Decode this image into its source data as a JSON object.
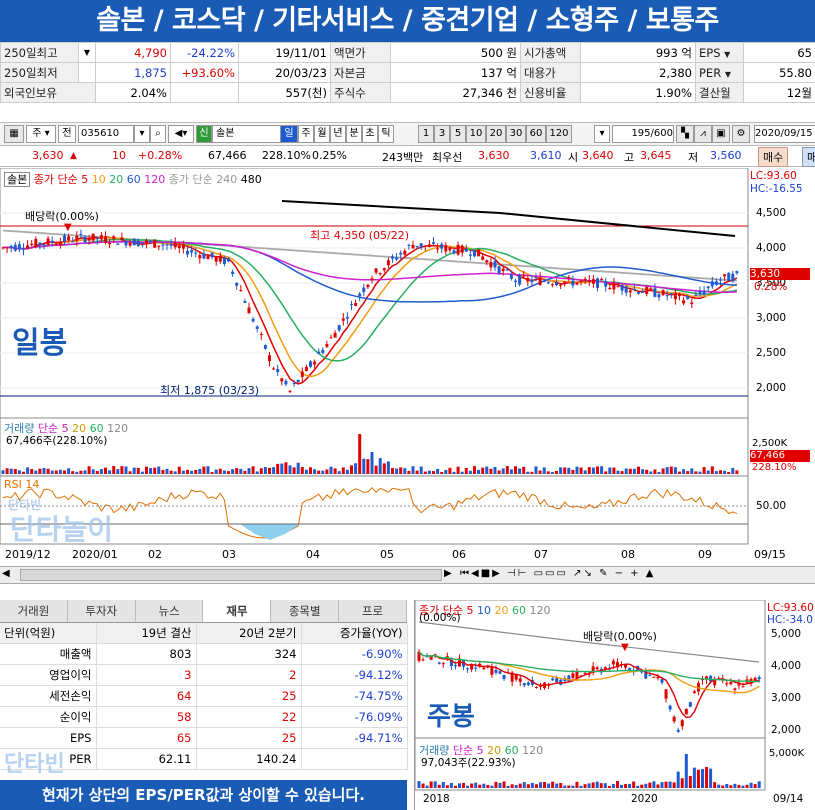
{
  "banner": {
    "title": "솔본 / 코스닥 / 기타서비스 / 중견기업 / 소형주 / 보통주"
  },
  "info_rows": [
    {
      "l1": "250일최고",
      "v1": "4,790",
      "c1": "-24.22%",
      "d1": "19/11/01",
      "l2": "액면가",
      "v2": "500 원",
      "l3": "시가총액",
      "v3": "993 억",
      "l4": "EPS",
      "v4": "65"
    },
    {
      "l1": "250일최저",
      "v1": "1,875",
      "c1": "+93.60%",
      "d1": "20/03/23",
      "l2": "자본금",
      "v2": "137 억",
      "l3": "대용가",
      "v3": "2,380",
      "l4": "PER",
      "v4": "55.80"
    },
    {
      "l1": "외국인보유",
      "v1": "2.04%",
      "c1": "",
      "d1": "557(천)",
      "l2": "주식수",
      "v2": "27,346 천",
      "l3": "신용비율",
      "v3": "1.90%",
      "l4": "결산월",
      "v4": "12월"
    }
  ],
  "toolbar": {
    "mode": "주",
    "prev": "전",
    "code": "035610",
    "name": "솔본",
    "periods": [
      "일",
      "주",
      "월",
      "년",
      "분",
      "초",
      "틱"
    ],
    "intervals": [
      "1",
      "3",
      "5",
      "10",
      "20",
      "30",
      "60",
      "120"
    ],
    "count": "195",
    "total": "/600",
    "date": "2020/09/15"
  },
  "quote": {
    "price": "3,630",
    "change": "10",
    "pct": "+0.28%",
    "volume": "67,466",
    "vol_ratio": "228.10%",
    "turnover": "0.25%",
    "amount": "243백만",
    "best_label": "최우선",
    "best_bid": "3,630",
    "best_ask": "3,610",
    "open_label": "시",
    "open": "3,640",
    "high_label": "고",
    "high": "3,645",
    "low_label": "저",
    "low": "3,560",
    "buy": "매수",
    "sell": "매"
  },
  "chart": {
    "legend_name": "솔본",
    "legend_ma": "종가 단순",
    "ma_periods": [
      "5",
      "10",
      "20",
      "60",
      "120"
    ],
    "ma_colors": [
      "#e00000",
      "#f39c12",
      "#27ae60",
      "#1f5bd0",
      "#d020d0"
    ],
    "legend_long": "종가 단순 240",
    "legend_long2": "480",
    "dividend": "배당락(0.00%)",
    "high_label": "최고 4,350 (05/22)",
    "low_label": "최저 1,875 (03/23)",
    "tag": "일봉",
    "lc": "LC:93.60",
    "hc": "HC:-16.55",
    "price_ticks": [
      "4,500",
      "4,000",
      "3,500",
      "3,000",
      "2,500",
      "2,000"
    ],
    "last_price": "3,630",
    "last_pct": "0.28%",
    "volume_legend": "거래량",
    "volume_ma": "단순",
    "volume_ma_periods": [
      "5",
      "20",
      "60",
      "120"
    ],
    "volume_info": "67,466주(228.10%)",
    "vol_tick": "2,500K",
    "vol_last": "67,466",
    "vol_last_pct": "228.10%",
    "rsi_label": "RSI 14",
    "rsi_tick": "50.00",
    "x_labels": [
      "2019/12",
      "2020/01",
      "02",
      "03",
      "04",
      "05",
      "06",
      "07",
      "08",
      "09"
    ],
    "x_end": "09/15",
    "watermark": "단타놀이",
    "watermark_small": "단타빈"
  },
  "financial": {
    "tabs": [
      "거래원",
      "투자자",
      "뉴스",
      "재무",
      "종목별",
      "프로"
    ],
    "active_tab": "재무",
    "headers": [
      "단위(억원)",
      "19년 결산",
      "20년 2분기",
      "증가율(YOY)"
    ],
    "rows": [
      {
        "name": "매출액",
        "a": "803",
        "b": "324",
        "g": "-6.90%"
      },
      {
        "name": "영업이익",
        "a": "3",
        "b": "2",
        "g": "-94.12%"
      },
      {
        "name": "세전손익",
        "a": "64",
        "b": "25",
        "g": "-74.75%"
      },
      {
        "name": "순이익",
        "a": "58",
        "b": "22",
        "g": "-76.09%"
      },
      {
        "name": "EPS",
        "a": "65",
        "b": "25",
        "g": "-94.71%"
      },
      {
        "name": "PER",
        "a": "62.11",
        "b": "140.24",
        "g": ""
      }
    ]
  },
  "weekly": {
    "legend": "종가 단순",
    "ma_periods": [
      "5",
      "10",
      "20",
      "60",
      "120"
    ],
    "dividend_top": "(0.00%)",
    "dividend": "배당락(0.00%)",
    "tag": "주봉",
    "lc": "LC:93.60",
    "hc": "HC:-34.0",
    "price_ticks": [
      "5,000",
      "4,000",
      "3,000",
      "2,000"
    ],
    "volume_legend": "거래량",
    "volume_ma": "단순",
    "volume_ma_periods": [
      "5",
      "20",
      "60",
      "120"
    ],
    "volume_info": "97,043주(22.93%)",
    "vol_tick": "5,000K",
    "x_labels": [
      "2018",
      "2020"
    ],
    "x_end": "09/14"
  },
  "notice": "현재가 상단의 EPS/PER값과 상이할 수 있습니다."
}
